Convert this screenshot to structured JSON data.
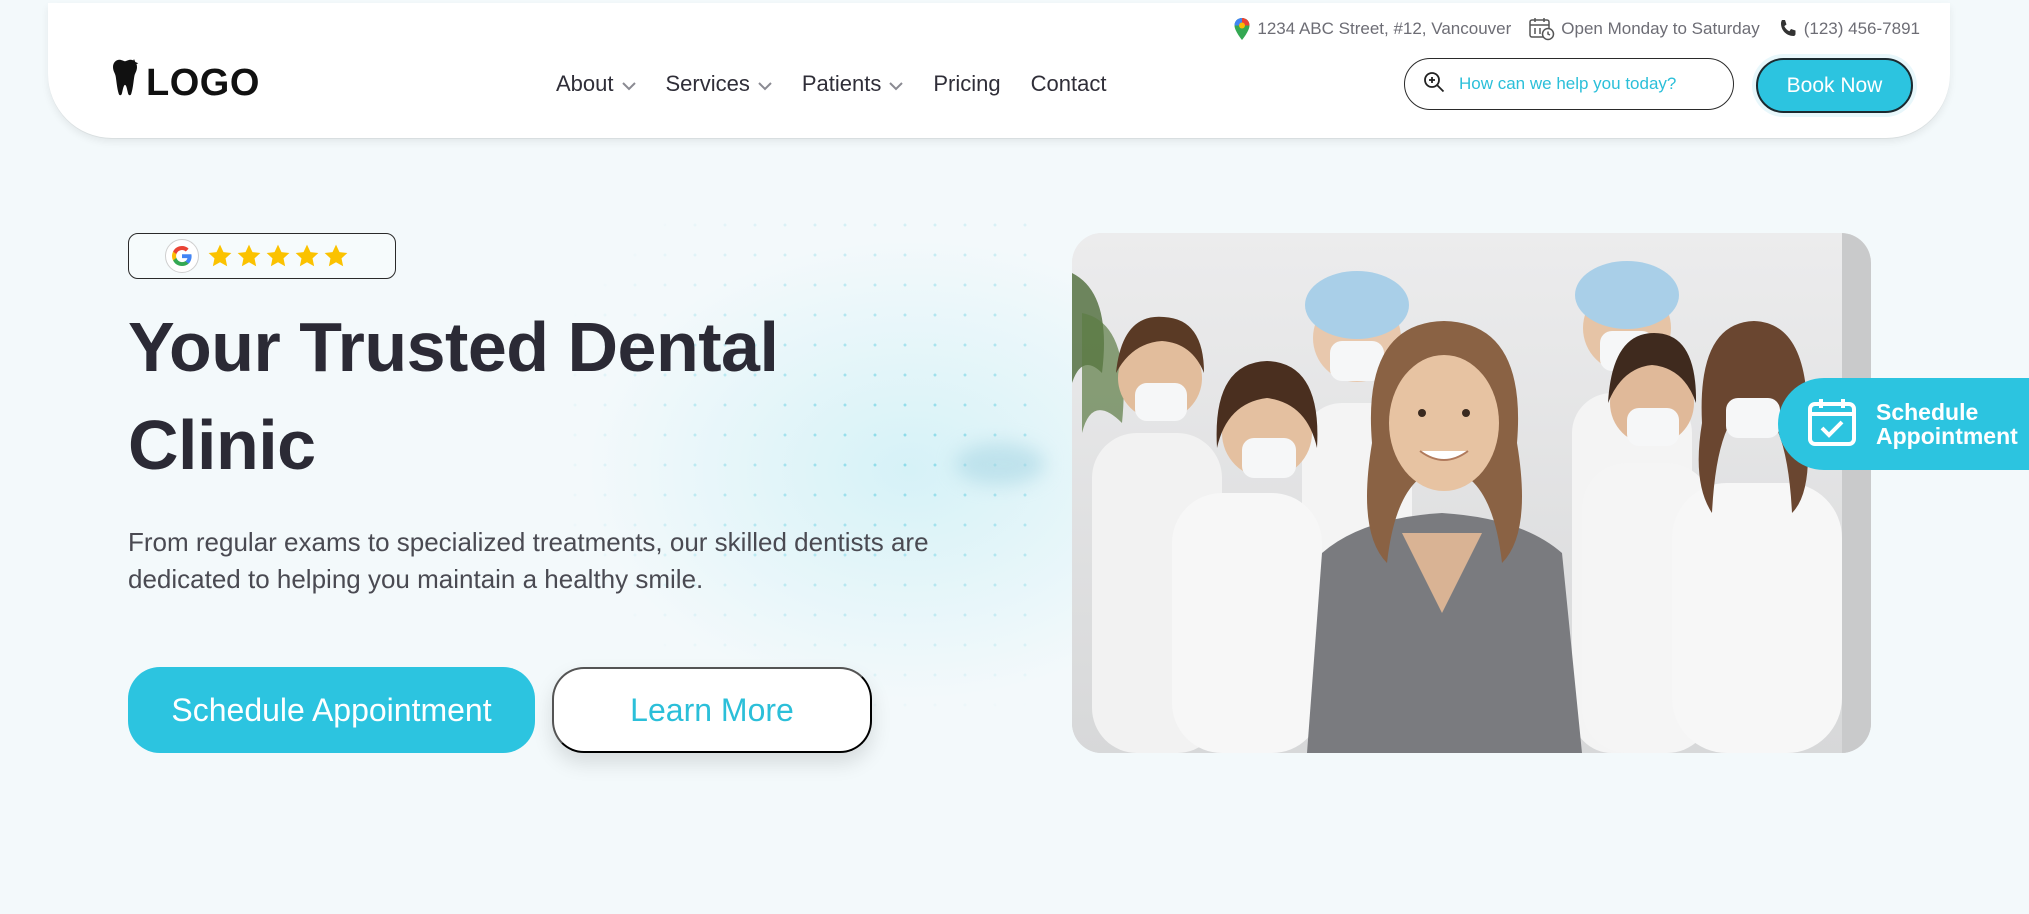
{
  "header": {
    "logo_text": "LOGO",
    "logo_icon": "tooth-icon",
    "topbar": {
      "address": "1234 ABC Street, #12, Vancouver",
      "hours": "Open Monday to Saturday",
      "phone": "(123) 456-7891"
    },
    "nav": [
      {
        "label": "About",
        "dropdown": true
      },
      {
        "label": "Services",
        "dropdown": true
      },
      {
        "label": "Patients",
        "dropdown": true
      },
      {
        "label": "Pricing",
        "dropdown": false
      },
      {
        "label": "Contact",
        "dropdown": false
      }
    ],
    "search": {
      "placeholder": "How can we help you today?"
    },
    "book_button": "Book Now"
  },
  "hero": {
    "rating": {
      "source_icon": "google-icon",
      "stars": 5,
      "max_stars": 5
    },
    "title": "Your Trusted Dental Clinic",
    "subtitle": "From regular exams to specialized treatments, our skilled dentists are dedicated to helping you maintain a healthy smile.",
    "primary_button": "Schedule Appointment",
    "secondary_button": "Learn More",
    "image_icon": "dental-team-photo"
  },
  "floating_tab": {
    "line1": "Schedule",
    "line2": "Appointment",
    "icon": "calendar-check-icon"
  },
  "colors": {
    "accent": "#2cc4e0",
    "star": "#fbc200",
    "heading": "#2b2a35",
    "background": "#f3f9fb"
  }
}
